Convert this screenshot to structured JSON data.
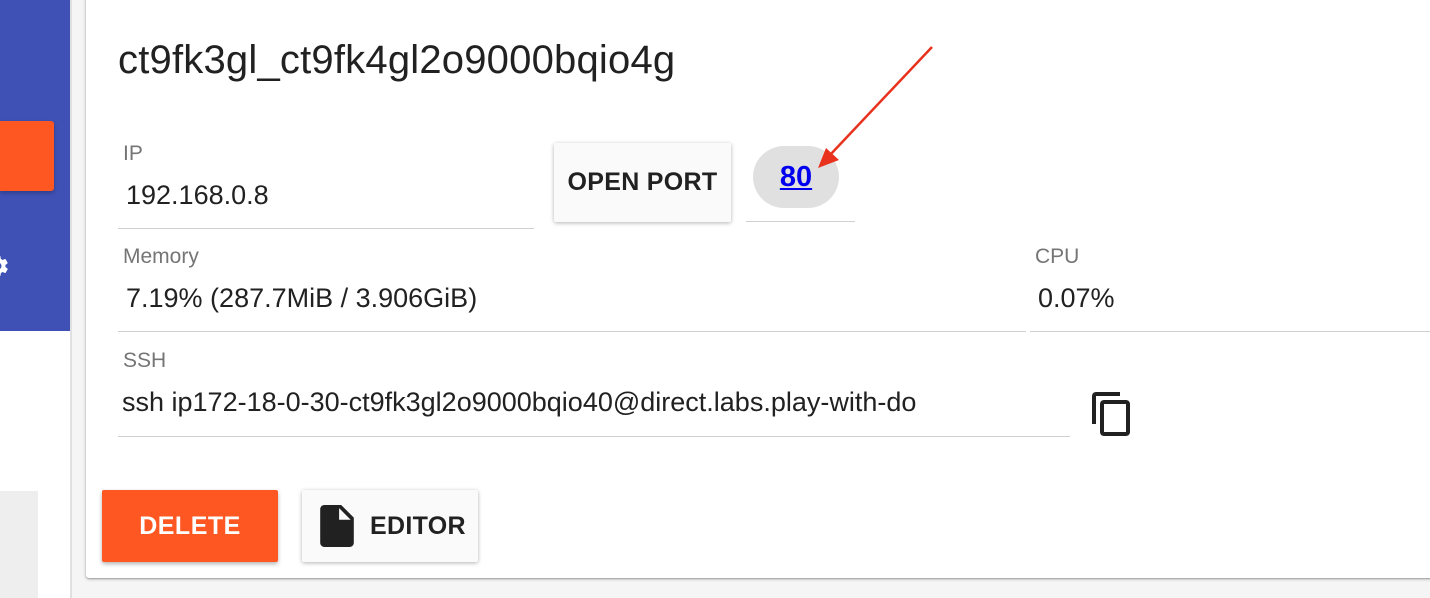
{
  "instance": {
    "title": "ct9fk3gl_ct9fk4gl2o9000bqio4g",
    "ip": {
      "label": "IP",
      "value": "192.168.0.8"
    },
    "open_port_label": "OPEN PORT",
    "ports": [
      {
        "label": "80"
      }
    ],
    "memory": {
      "label": "Memory",
      "value": "7.19% (287.7MiB / 3.906GiB)"
    },
    "cpu": {
      "label": "CPU",
      "value": "0.07%"
    },
    "ssh": {
      "label": "SSH",
      "value": "ssh ip172-18-0-30-ct9fk3gl2o9000bqio40@direct.labs.play-with-do"
    },
    "delete_label": "DELETE",
    "editor_label": "EDITOR"
  },
  "icons": {
    "copy": "copy-icon",
    "document": "document-icon",
    "settings": "gear-icon",
    "annotation": "red-arrow"
  },
  "colors": {
    "sidebar": "#3f51b5",
    "accent": "#ff5722",
    "link": "#0000ee",
    "chip": "#e0e0e0",
    "annotation": "#e8321e"
  }
}
